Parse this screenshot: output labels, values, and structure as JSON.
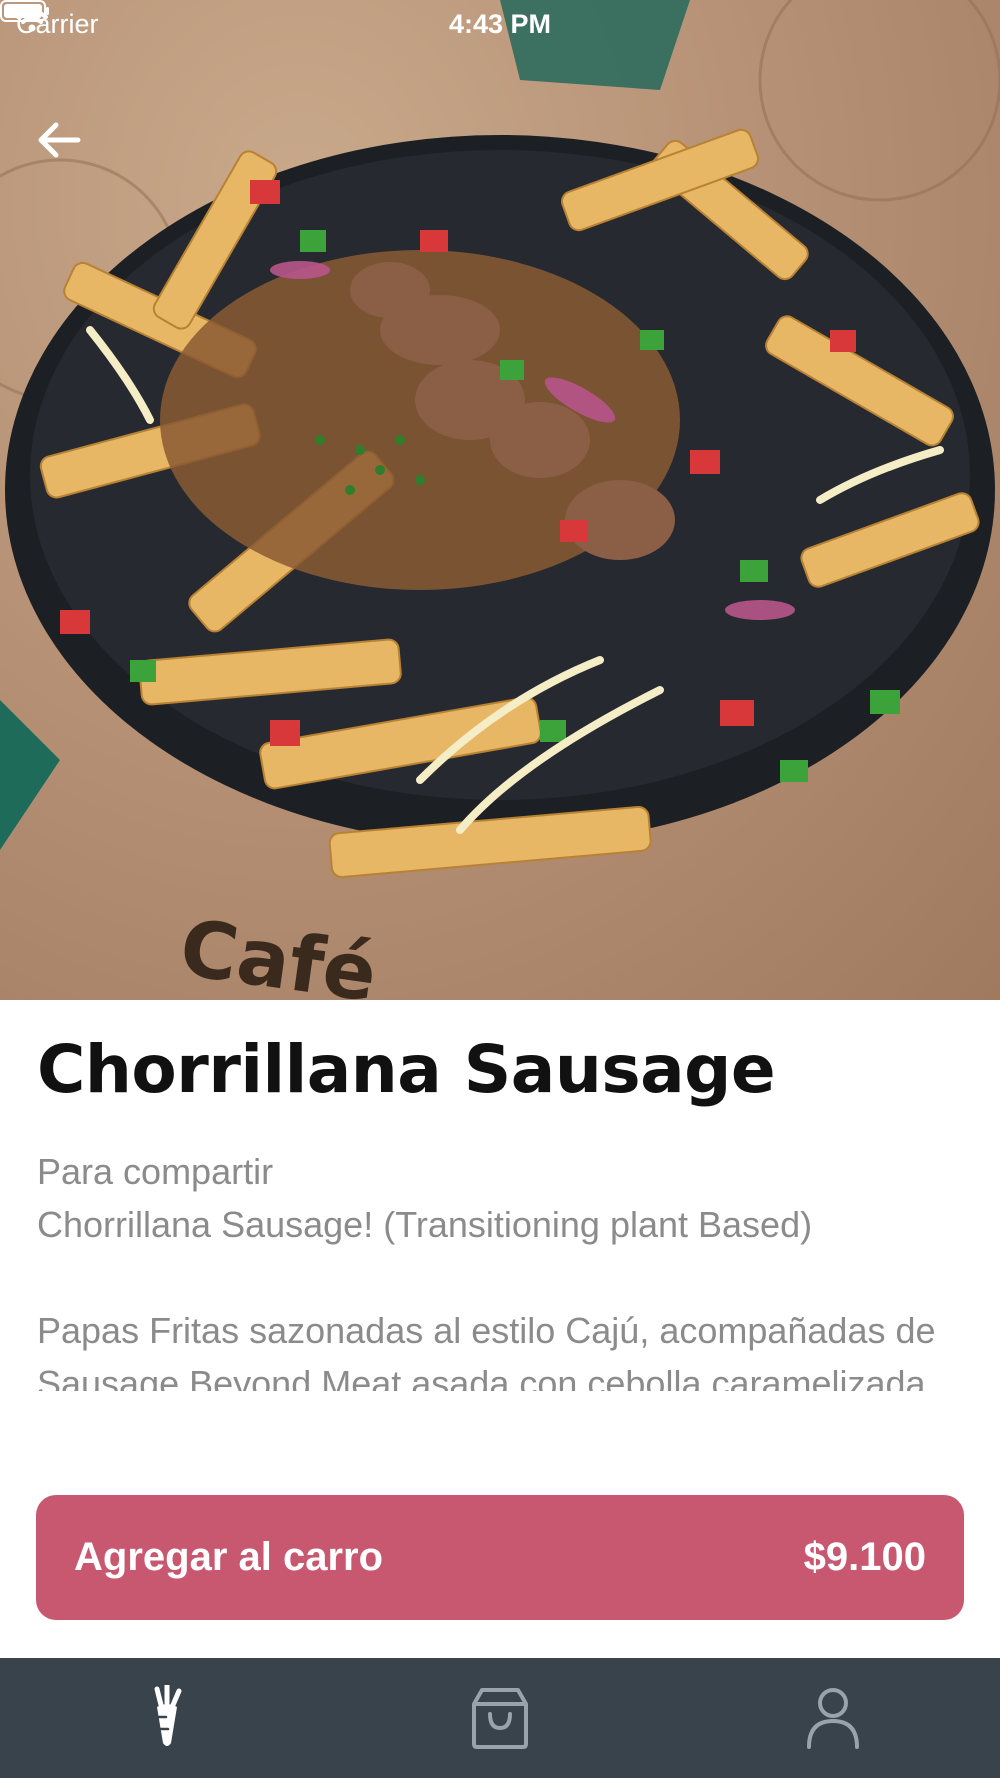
{
  "status_bar": {
    "carrier": "Carrier",
    "time": "4:43 PM"
  },
  "product": {
    "title": "Chorrillana Sausage",
    "description": "Para compartir\nChorrillana Sausage! (Transitioning  plant Based)\n\nPapas Fritas sazonadas al estilo Cajú, acompañadas de  Sausage Beyond Meat asada con cebolla caramelizada, pico de gallo cajú, queso mezzarella y"
  },
  "cart_button": {
    "label": "Agregar al carro",
    "price": "$9.100",
    "color": "#c85870"
  },
  "tab_bar": {
    "background": "#38434b",
    "tabs": [
      {
        "icon": "carrot-icon",
        "active": true
      },
      {
        "icon": "shopping-bag-icon",
        "active": false
      },
      {
        "icon": "user-icon",
        "active": false
      }
    ]
  }
}
